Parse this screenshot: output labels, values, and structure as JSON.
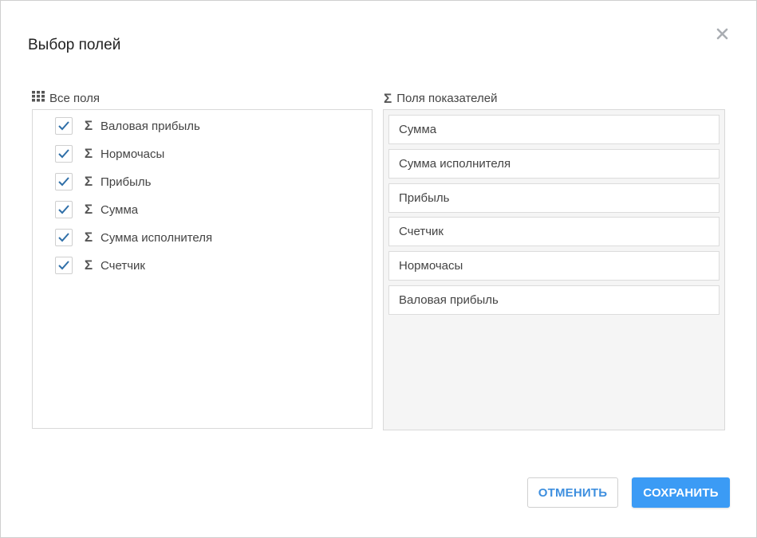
{
  "dialog": {
    "title": "Выбор полей",
    "close_icon": "close-icon"
  },
  "all_fields": {
    "label": "Все поля",
    "icon": "grid-icon",
    "items": [
      {
        "label": "Валовая прибыль",
        "checked": true,
        "icon": "sigma-icon"
      },
      {
        "label": "Нормочасы",
        "checked": true,
        "icon": "sigma-icon"
      },
      {
        "label": "Прибыль",
        "checked": true,
        "icon": "sigma-icon"
      },
      {
        "label": "Сумма",
        "checked": true,
        "icon": "sigma-icon"
      },
      {
        "label": "Сумма исполнителя",
        "checked": true,
        "icon": "sigma-icon"
      },
      {
        "label": "Счетчик",
        "checked": true,
        "icon": "sigma-icon"
      }
    ]
  },
  "measures": {
    "label": "Поля показателей",
    "icon": "sigma-icon",
    "items": [
      {
        "label": "Сумма"
      },
      {
        "label": "Сумма исполнителя"
      },
      {
        "label": "Прибыль"
      },
      {
        "label": "Счетчик"
      },
      {
        "label": "Нормочасы"
      },
      {
        "label": "Валовая прибыль"
      }
    ]
  },
  "buttons": {
    "cancel_label": "ОТМЕНИТЬ",
    "save_label": "СОХРАНИТЬ"
  },
  "colors": {
    "accent": "#3b9bf5",
    "checkmark": "#2f6fa8",
    "measures_bg": "#f5f5f5"
  }
}
